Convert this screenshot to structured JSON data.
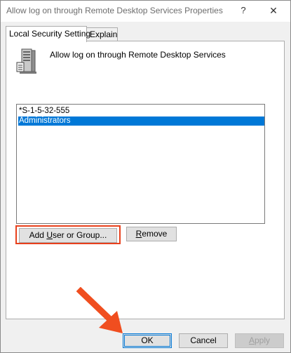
{
  "window": {
    "title": "Allow log on through Remote Desktop Services Properties",
    "help_glyph": "?",
    "close_glyph": "✕"
  },
  "tabs": [
    {
      "label": "Local Security Setting",
      "active": true
    },
    {
      "label": "Explain",
      "active": false
    }
  ],
  "policy": {
    "name": "Allow log on through Remote Desktop Services",
    "icon": "server-icon"
  },
  "principals": [
    {
      "name": "*S-1-5-32-555",
      "selected": false
    },
    {
      "name": "Administrators",
      "selected": true
    }
  ],
  "actions": {
    "add_label_pre": "Add ",
    "add_label_acc": "U",
    "add_label_post": "ser or Group...",
    "remove_label_acc": "R",
    "remove_label_post": "emove"
  },
  "footer": {
    "ok_label": "OK",
    "cancel_label": "Cancel",
    "apply_label_pre": "",
    "apply_label_acc": "A",
    "apply_label_post": "pply"
  },
  "annotations": {
    "highlight_color": "#e8401c",
    "arrow_color": "#f04e1f",
    "selection_color": "#0078d7"
  }
}
